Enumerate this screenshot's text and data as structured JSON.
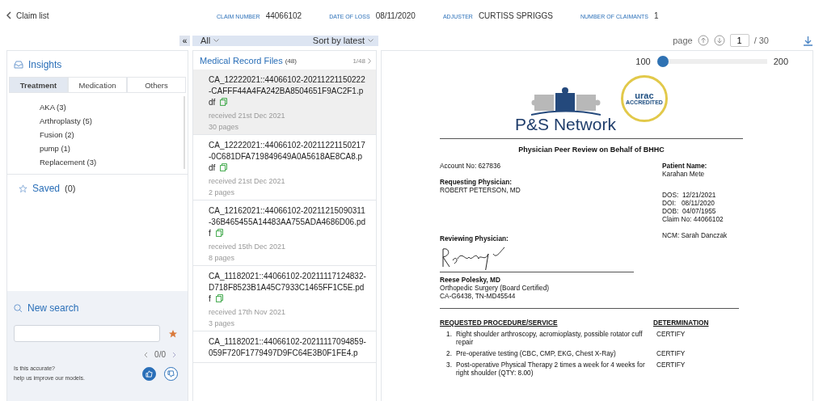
{
  "header": {
    "back_label": "Claim list",
    "fields": [
      {
        "label": "CLAIM NUMBER",
        "value": "44066102"
      },
      {
        "label": "DATE OF LOSS",
        "value": "08/11/2020"
      },
      {
        "label": "ADJUSTER",
        "value": "CURTISS SPRIGGS"
      },
      {
        "label": "NUMBER OF CLAIMANTS",
        "value": "1"
      }
    ]
  },
  "toolbar": {
    "collapse": "«",
    "filter": "All",
    "sort": "Sort by latest",
    "page_label": "page",
    "page": "1",
    "page_total": "/ 30"
  },
  "insights": {
    "title": "Insights",
    "tabs": [
      {
        "label": "Treatment",
        "selected": true
      },
      {
        "label": "Medication",
        "selected": false
      },
      {
        "label": "Others",
        "selected": false
      }
    ],
    "items": [
      "AKA (3)",
      "Arthroplasty (5)",
      "Fusion (2)",
      "pump (1)",
      "Replacement (3)"
    ]
  },
  "saved": {
    "title": "Saved",
    "count": "(0)"
  },
  "search": {
    "title": "New search",
    "counter": "0/0",
    "feedback_question": "Is this accurate?",
    "feedback_hint": "help us improve our models."
  },
  "files": {
    "title": "Medical Record Files",
    "count": "(48)",
    "position": "1/48",
    "items": [
      {
        "name": "CA_12222021::44066102-20211221150222-CAFFF44A4FA242BA8504651F9AC2F1.pdf",
        "received": "received 21st Dec 2021",
        "pages": "30 pages",
        "selected": true
      },
      {
        "name": "CA_12222021::44066102-20211221150217-0C681DFA719849649A0A5618AE8CA8.pdf",
        "received": "received 21st Dec 2021",
        "pages": "2 pages",
        "selected": false
      },
      {
        "name": "CA_12162021::44066102-20211215090311-36B465455A14483AA755ADA4686D06.pdf",
        "received": "received 15th Dec 2021",
        "pages": "8 pages",
        "selected": false
      },
      {
        "name": "CA_11182021::44066102-20211117124832-D718F8523B1A45C7933C1465FF1C5E.pdf",
        "received": "received 17th Nov 2021",
        "pages": "3 pages",
        "selected": false
      },
      {
        "name": "CA_11182021::44066102-20211117094859-059F720F1779497D9FC64E3B0F1FE4.p",
        "selected": false
      }
    ]
  },
  "viewer": {
    "zoom_min": "100",
    "zoom_max": "200",
    "level": 0,
    "document": {
      "logo_text": "P&S Network",
      "badge_text": "urac",
      "badge_sub": "ACCREDITED",
      "title": "Physician Peer Review on Behalf of BHHC",
      "account": "Account No: 627836",
      "requesting_label": "Requesting Physician:",
      "requesting_name": "ROBERT PETERSON, MD",
      "patient_label": "Patient Name:",
      "patient_name": "Karahan Mete",
      "patient_lines": [
        "DOS:  12/21/2021",
        "DOI:   08/11/2020",
        "DOB:  04/07/1955",
        "Claim No: 44066102"
      ],
      "ncm": "NCM: Sarah Danczak",
      "reviewing_label": "Reviewing Physician:",
      "reviewer_name": "Reese Polesky, MD",
      "reviewer_lines": [
        "Orthopedic Surgery (Board Certified)",
        "CA-G6438, TN-MD45544"
      ],
      "col_procedure": "REQUESTED PROCEDURE/SERVICE",
      "col_determination": "DETERMINATION",
      "rows": [
        {
          "num": "1.",
          "procedure": "Right shoulder arthroscopy, acromioplasty, possible rotator cuff repair",
          "determination": "CERTIFY"
        },
        {
          "num": "2.",
          "procedure": "Pre-operative testing (CBC, CMP, EKG, Chest X-Ray)",
          "determination": "CERTIFY"
        },
        {
          "num": "3.",
          "procedure": "Post-operative Physical Therapy 2 times a week for 4 weeks for right shoulder (QTY: 8.00)",
          "determination": "CERTIFY"
        }
      ]
    }
  }
}
